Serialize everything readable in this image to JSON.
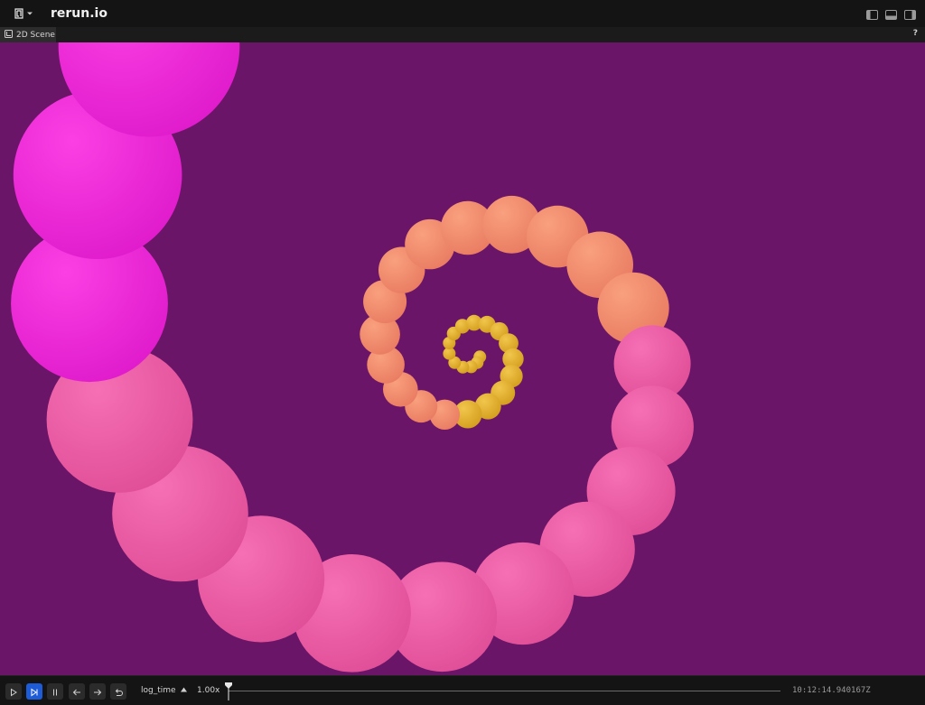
{
  "app": {
    "title": "rerun.io"
  },
  "topbar": {
    "icons": [
      "rerun-logo-icon",
      "left-panel-toggle-icon",
      "bottom-panel-toggle-icon",
      "right-panel-toggle-icon"
    ]
  },
  "tabbar": {
    "tab_label": "2D Scene",
    "help_label": "?"
  },
  "bottom": {
    "timeline": "log_time",
    "speed": "1.00x",
    "timestamp": "10:12:14.940167Z",
    "controls": [
      "play-icon",
      "step-forward-icon",
      "pause-icon",
      "arrow-left-icon",
      "arrow-right-icon",
      "loop-icon"
    ]
  },
  "colors": {
    "background": "#6b1568",
    "inner_spiral": "#e0b02c",
    "middle_spiral": "#f4906a",
    "outer_spiral": "#f05fa8",
    "edge_spiral": "#f22ad8",
    "active_control": "#1e5bd6"
  }
}
